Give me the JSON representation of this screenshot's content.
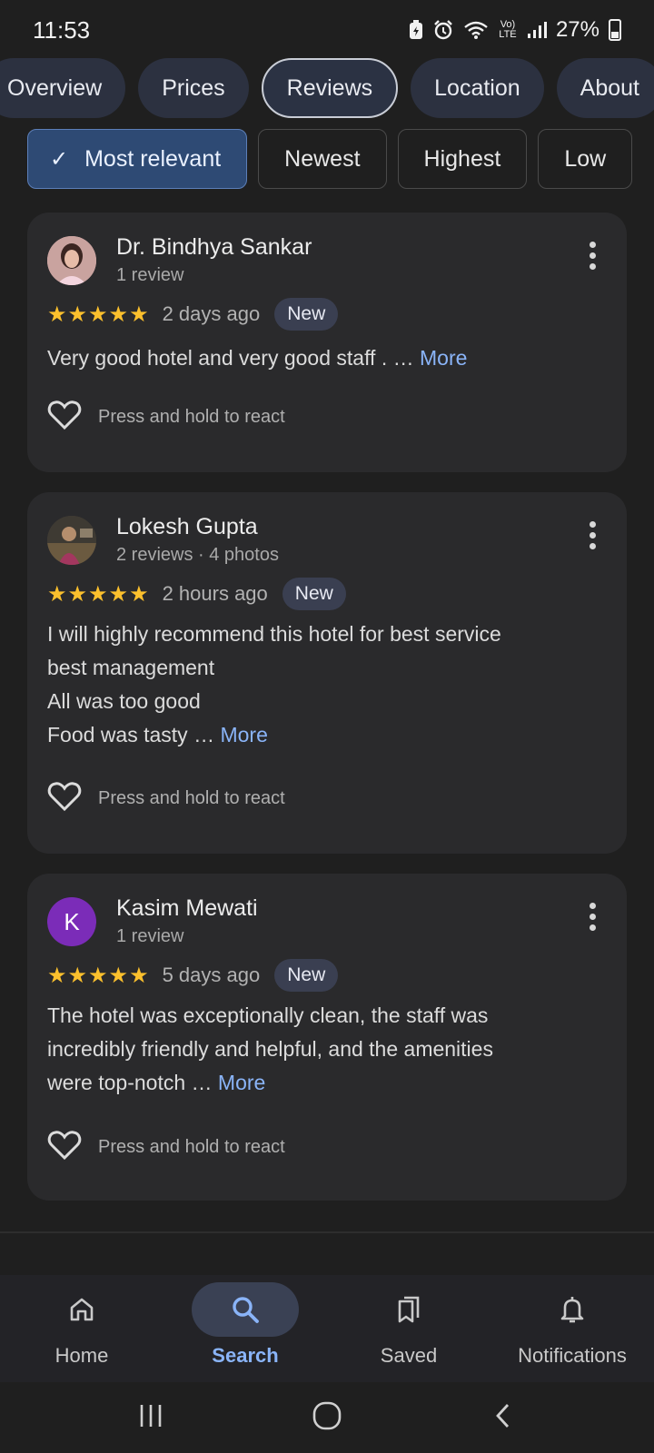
{
  "status_bar": {
    "time": "11:53",
    "battery": "27%",
    "volte": "Vo) LTE",
    "icons": [
      "battery-saver-icon",
      "alarm-icon",
      "wifi-icon",
      "volte-icon",
      "signal-icon",
      "battery-icon"
    ]
  },
  "tabs": [
    {
      "label": "Overview"
    },
    {
      "label": "Prices"
    },
    {
      "label": "Reviews",
      "active": true
    },
    {
      "label": "Location"
    },
    {
      "label": "About"
    }
  ],
  "filters": [
    {
      "label": "Most relevant",
      "selected": true
    },
    {
      "label": "Newest"
    },
    {
      "label": "Highest"
    },
    {
      "label": "Low"
    }
  ],
  "reviews": [
    {
      "author": "Dr. Bindhya Sankar",
      "meta": "1 review",
      "rating": 5,
      "stars": "★★★★★",
      "time": "2 days ago",
      "badge": "New",
      "text_lines": [
        "Very good hotel and very good staff . … "
      ],
      "more": "More",
      "react_label": "Press and hold to react"
    },
    {
      "author": "Lokesh Gupta",
      "meta": "2 reviews · 4 photos",
      "rating": 5,
      "stars": "★★★★★",
      "time": "2 hours ago",
      "badge": "New",
      "text_lines": [
        "I will highly recommend this hotel for best service",
        "best management",
        "All was too good",
        "Food was tasty … "
      ],
      "more": "More",
      "react_label": "Press and hold to react"
    },
    {
      "author": "Kasim Mewati",
      "meta": "1 review",
      "avatar_letter": "K",
      "rating": 5,
      "stars": "★★★★★",
      "time": "5 days ago",
      "badge": "New",
      "text_lines": [
        "The hotel was exceptionally clean, the staff was",
        "incredibly friendly and helpful, and the amenities",
        "were top-notch … "
      ],
      "more": "More",
      "react_label": "Press and hold to react"
    }
  ],
  "bottom_nav": [
    {
      "label": "Home",
      "icon": "home-icon"
    },
    {
      "label": "Search",
      "icon": "search-icon",
      "active": true
    },
    {
      "label": "Saved",
      "icon": "saved-icon"
    },
    {
      "label": "Notifications",
      "icon": "bell-icon"
    }
  ],
  "colors": {
    "background": "#1f1f1f",
    "card": "#2a2a2c",
    "accent_link": "#8ab4f8",
    "star": "#fbc02d",
    "selected_chip": "#2e4a74",
    "avatar_k": "#7b2cb8"
  }
}
